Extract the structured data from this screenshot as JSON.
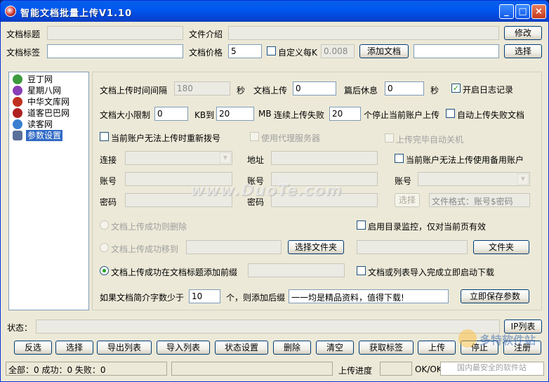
{
  "window": {
    "title": "智能文档批量上传V1.10"
  },
  "top": {
    "doc_title_label": "文档标题",
    "doc_intro_label": "文件介绍",
    "edit_btn": "修改",
    "doc_tags_label": "文档标签",
    "doc_price_label": "文档价格",
    "doc_price_value": "5",
    "custom_each_label": "自定义每K",
    "custom_each_value": "0.008",
    "add_doc_btn": "添加文档",
    "select_btn": "选择"
  },
  "tree": {
    "items": [
      {
        "label": "豆丁网",
        "color": "#3d9a3d"
      },
      {
        "label": "星期八网",
        "color": "#8a3fb5"
      },
      {
        "label": "中华文库网",
        "color": "#c03020"
      },
      {
        "label": "道客巴巴网",
        "color": "#b02020"
      },
      {
        "label": "读客网",
        "color": "#3a7fd0"
      },
      {
        "label": "参数设置",
        "color": "#5a6f9a"
      }
    ]
  },
  "settings": {
    "upload_interval_label": "文档上传时间间隔",
    "upload_interval_value": "180",
    "sec1": "秒",
    "doc_upload_label": "文档上传",
    "doc_upload_value": "0",
    "rest_label": "篇后休息",
    "rest_value": "0",
    "sec2": "秒",
    "log_label": "开启日志记录",
    "size_limit_label": "文档大小限制",
    "size_min": "0",
    "kb_to": "KB到",
    "size_max": "20",
    "mb": "MB",
    "fail_label": "连续上传失败",
    "fail_value": "20",
    "fail_suffix": "个停止当前账户上传",
    "auto_fail_label": "自动上传失败文档",
    "redial_label": "当前账户无法上传时重新拨号",
    "proxy_label": "使用代理服务器",
    "shutdown_label": "上传完毕自动关机",
    "connect_label": "连接",
    "address_label": "地址",
    "backup_label": "当前账户无法上传使用备用账户",
    "account1": "账号",
    "account2": "账号",
    "account3": "账号",
    "pwd1": "密码",
    "pwd2": "密码",
    "select_btn": "选择",
    "file_format": "文件格式：账号$密码",
    "delete_label": "文档上传成功则删除",
    "monitor_label": "启用目录监控，仅对当前页有效",
    "move_label": "文档上传成功移到",
    "choose_folder_btn": "选择文件夹",
    "folder_btn": "文件夹",
    "prefix_label": "文档上传成功在文档标题添加前缀",
    "auto_download_label": "文档或列表导入完成立即启动下载",
    "intro_label": "如果文档简介字数少于",
    "intro_value": "10",
    "suffix_label": "个，则添加后缀",
    "suffix_value": "一一均是精品资料，值得下载!",
    "save_btn": "立即保存参数"
  },
  "status": {
    "label": "状态：",
    "ip_btn": "IP列表"
  },
  "buttons": [
    "反选",
    "选择",
    "导出列表",
    "导入列表",
    "状态设置",
    "删除",
    "清空",
    "获取标签",
    "上传",
    "停止",
    "注册"
  ],
  "bottom": {
    "counts": "全部：0 成功：0 失败：0",
    "progress_label": "上传进度",
    "ok": "OK/OK"
  },
  "watermark": {
    "main": "www.DuoTe.com",
    "side1": "多特软件站",
    "side2": "国内最安全的软件站"
  }
}
